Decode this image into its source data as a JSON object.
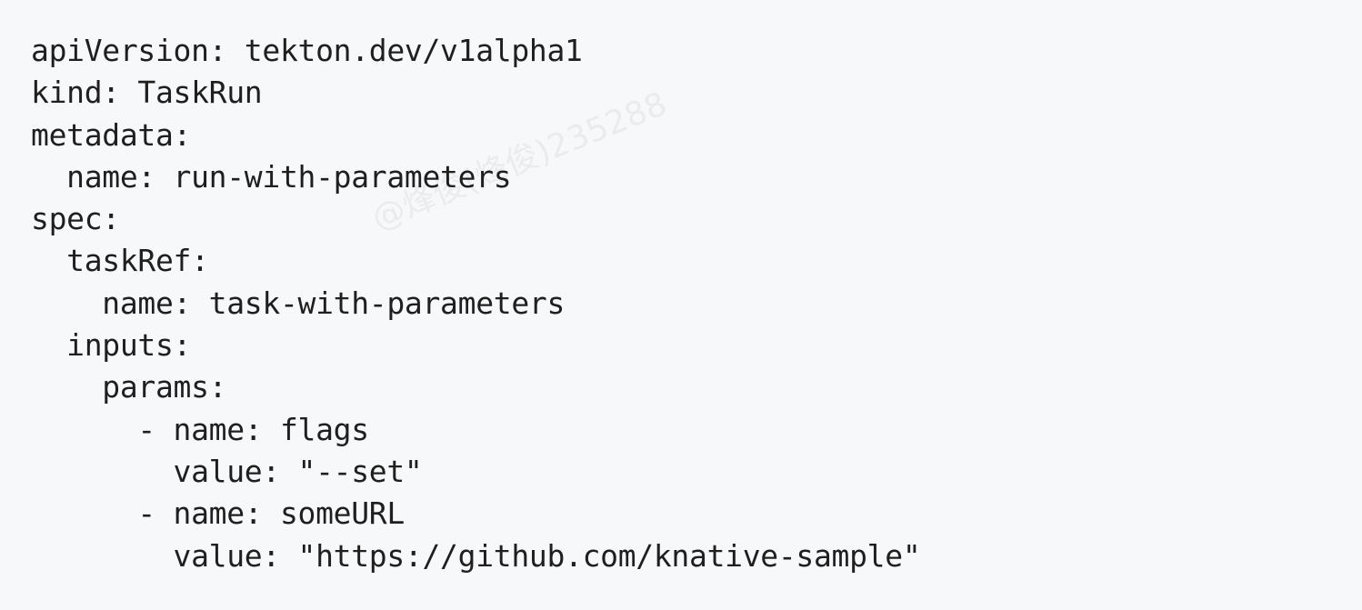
{
  "code": {
    "lines": [
      "apiVersion: tekton.dev/v1alpha1",
      "kind: TaskRun",
      "metadata:",
      "  name: run-with-parameters",
      "spec:",
      "  taskRef:",
      "    name: task-with-parameters",
      "  inputs:",
      "    params:",
      "      - name: flags",
      "        value: \"--set\"",
      "      - name: someURL",
      "        value: \"https://github.com/knative-sample\""
    ]
  },
  "watermark": {
    "text": "@烽俊(烽俊)235288"
  },
  "colors": {
    "background": "#f7f8fa",
    "text": "#1f1f1f"
  }
}
